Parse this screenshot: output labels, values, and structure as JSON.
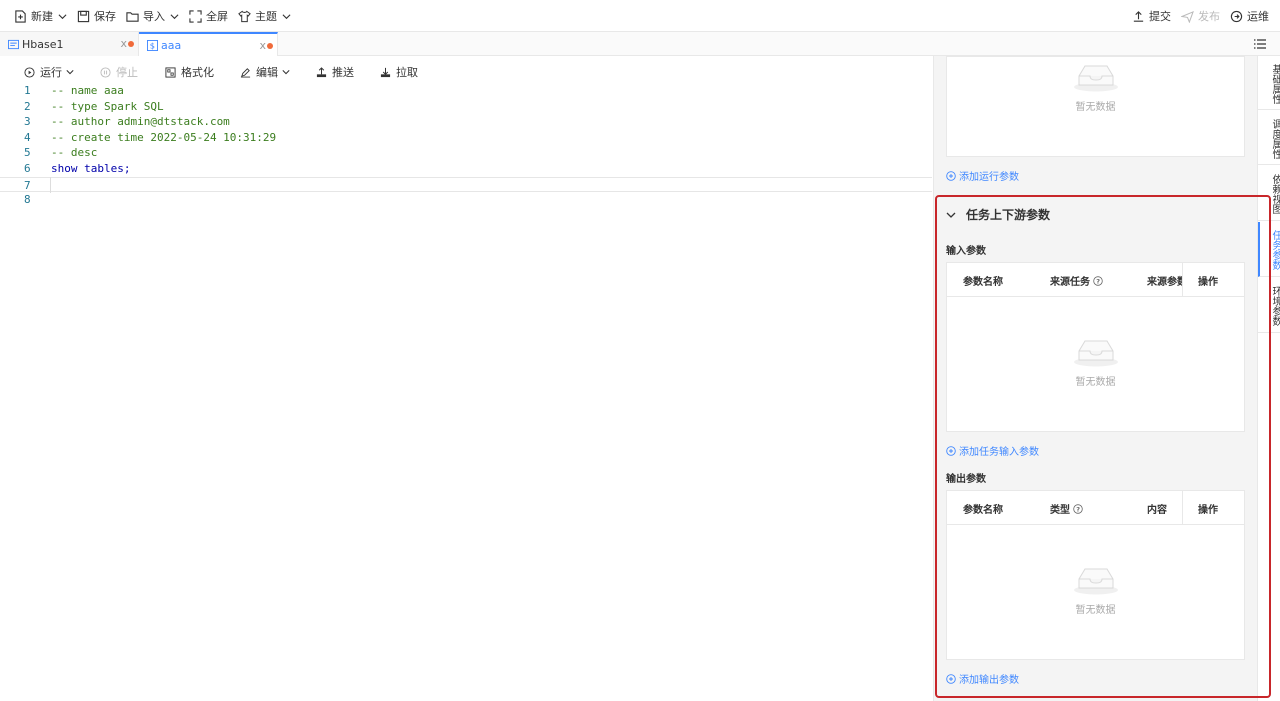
{
  "toolbar": {
    "left": [
      {
        "label": "新建",
        "icon": "new-file-icon",
        "dropdown": true
      },
      {
        "label": "保存",
        "icon": "save-icon",
        "dropdown": false
      },
      {
        "label": "导入",
        "icon": "folder-icon",
        "dropdown": true
      },
      {
        "label": "全屏",
        "icon": "fullscreen-icon",
        "dropdown": false
      },
      {
        "label": "主题",
        "icon": "shirt-icon",
        "dropdown": true
      }
    ],
    "right": [
      {
        "label": "提交",
        "icon": "upload-icon",
        "disabled": false
      },
      {
        "label": "发布",
        "icon": "send-icon",
        "disabled": true
      },
      {
        "label": "运维",
        "icon": "ops-icon",
        "disabled": false
      }
    ]
  },
  "tabs": [
    {
      "label": "Hbase1",
      "icon": "hbase-icon",
      "active": false
    },
    {
      "label": "aaa",
      "icon": "sql-icon",
      "active": true
    }
  ],
  "editor_toolbar": {
    "run": "运行",
    "stop": "停止",
    "format": "格式化",
    "edit": "编辑",
    "push": "推送",
    "pull": "拉取"
  },
  "code": [
    {
      "n": "1",
      "text": "-- name aaa",
      "kind": "comment"
    },
    {
      "n": "2",
      "text": "-- type Spark SQL",
      "kind": "comment"
    },
    {
      "n": "3",
      "text": "-- author admin@dtstack.com",
      "kind": "comment"
    },
    {
      "n": "4",
      "text": "-- create time 2022-05-24 10:31:29",
      "kind": "comment"
    },
    {
      "n": "5",
      "text": "-- desc",
      "kind": "comment"
    },
    {
      "n": "6",
      "text": "show tables;",
      "kind": "code"
    },
    {
      "n": "7",
      "text": "",
      "kind": "code"
    },
    {
      "n": "8",
      "text": "",
      "kind": "code"
    }
  ],
  "panel": {
    "empty_text": "暂无数据",
    "add_run_param": "添加运行参数",
    "section_title": "任务上下游参数",
    "input_title": "输入参数",
    "input_columns": [
      "参数名称",
      "来源任务",
      "来源参数",
      "操作"
    ],
    "add_input_param": "添加任务输入参数",
    "output_title": "输出参数",
    "output_columns": [
      "参数名称",
      "类型",
      "内容",
      "操作"
    ],
    "add_output_param": "添加输出参数"
  },
  "vnav": [
    {
      "label": "基础属性",
      "active": false
    },
    {
      "label": "调度属性",
      "active": false
    },
    {
      "label": "依赖视图",
      "active": false
    },
    {
      "label": "任务参数",
      "active": true
    },
    {
      "label": "环境参数",
      "active": false
    }
  ],
  "colors": {
    "accent": "#3f87ff",
    "highlight": "#c8262a",
    "dirty_dot": "#f06a3a"
  }
}
